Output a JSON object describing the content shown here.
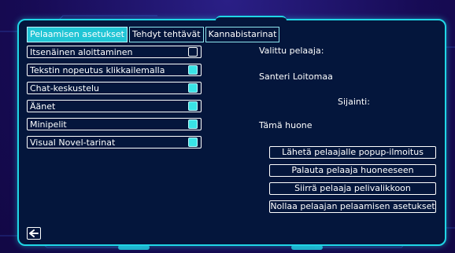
{
  "tabs": [
    {
      "label": "Pelaamisen asetukset",
      "active": true
    },
    {
      "label": "Tehdyt tehtävät",
      "active": false
    },
    {
      "label": "Kannabistarinat",
      "active": false
    }
  ],
  "settings": [
    {
      "label": "Itsenäinen aloittaminen",
      "checked": false
    },
    {
      "label": "Tekstin nopeutus klikkailemalla",
      "checked": true
    },
    {
      "label": "Chat-keskustelu",
      "checked": true
    },
    {
      "label": "Äänet",
      "checked": true
    },
    {
      "label": "Minipelit",
      "checked": true
    },
    {
      "label": "Visual Novel-tarinat",
      "checked": true
    }
  ],
  "player": {
    "selected_label": "Valittu pelaaja:",
    "name": "Santeri Loitomaa",
    "location_label": "Sijainti:",
    "location": "Tämä huone"
  },
  "actions": [
    "Lähetä pelaajalle popup-ilmoitus",
    "Palauta pelaaja huoneeseen",
    "Siirrä pelaaja pelivalikkoon",
    "Nollaa pelaajan pelaamisen asetukset"
  ],
  "back_icon": "arrow-left-icon",
  "colors": {
    "accent": "#20d6e6",
    "panel_bg": "#04163c",
    "page_bg": "#1a0f5e",
    "checked": "#39e3e6"
  }
}
